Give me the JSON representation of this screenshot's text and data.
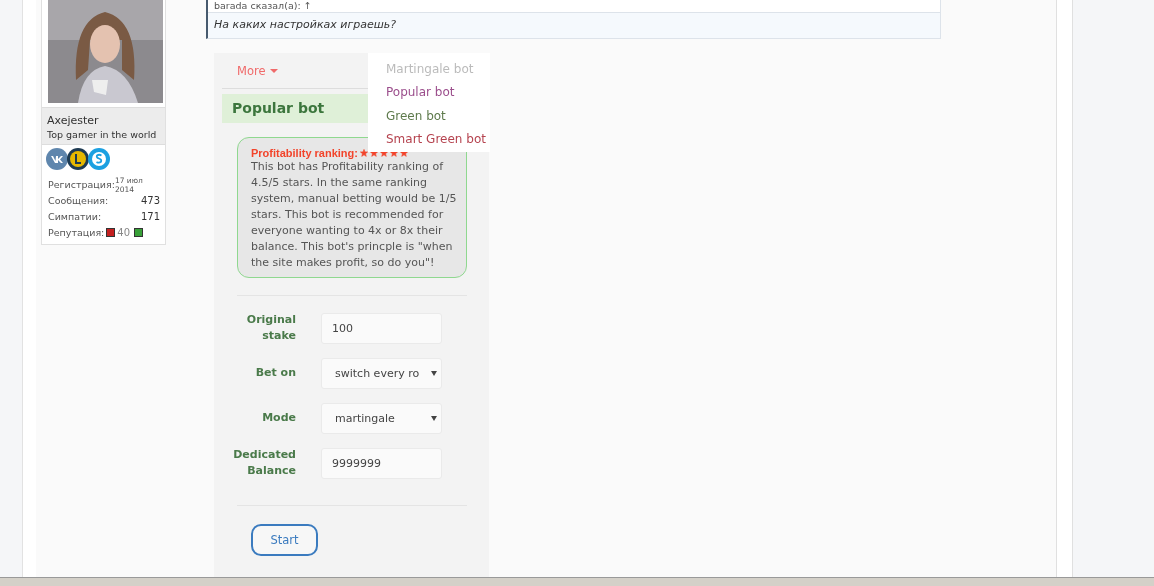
{
  "quote": {
    "author": "barada сказал(а): ↑",
    "text": "На каких настройках играешь?"
  },
  "user": {
    "name": "Axejester",
    "title": "Top gamer in the world",
    "stats": [
      {
        "label": "Регистрация:",
        "value": "17 июл 2014",
        "kind": "small"
      },
      {
        "label": "Сообщения:",
        "value": "473",
        "kind": "plain"
      },
      {
        "label": "Симпатии:",
        "value": "171",
        "kind": "plain"
      },
      {
        "label": "Репутация:",
        "value": "40",
        "kind": "reputation"
      }
    ]
  },
  "bot_panel": {
    "tabs": [
      {
        "label": "More",
        "selected": false
      }
    ],
    "menu": [
      {
        "label": "Martingale bot",
        "color": "#bbbbbb"
      },
      {
        "label": "Popular bot",
        "color": "#9b4e8c"
      },
      {
        "label": "Green bot",
        "color": "#5e7a4c"
      },
      {
        "label": "Smart Green bot",
        "color": "#b5434f"
      }
    ],
    "title": "Popular bot",
    "info": {
      "heading": "Profitability ranking:",
      "stars": 5,
      "text": "This bot has Profitability ranking of 4.5/5 stars. In the same ranking system, manual betting would be 1/5 stars. This bot is recommended for everyone wanting to 4x or 8x their balance. This bot's princple is \"when the site makes profit, so do you\"!"
    },
    "fields": [
      {
        "label": "Original stake",
        "kind": "input",
        "value": "100"
      },
      {
        "label": "Bet on",
        "kind": "select",
        "value": "switch every ro"
      },
      {
        "label": "Mode",
        "kind": "select",
        "value": "martingale"
      },
      {
        "label": "Dedicated Balance",
        "kind": "input",
        "value": "9999999"
      }
    ],
    "button": "Start"
  }
}
